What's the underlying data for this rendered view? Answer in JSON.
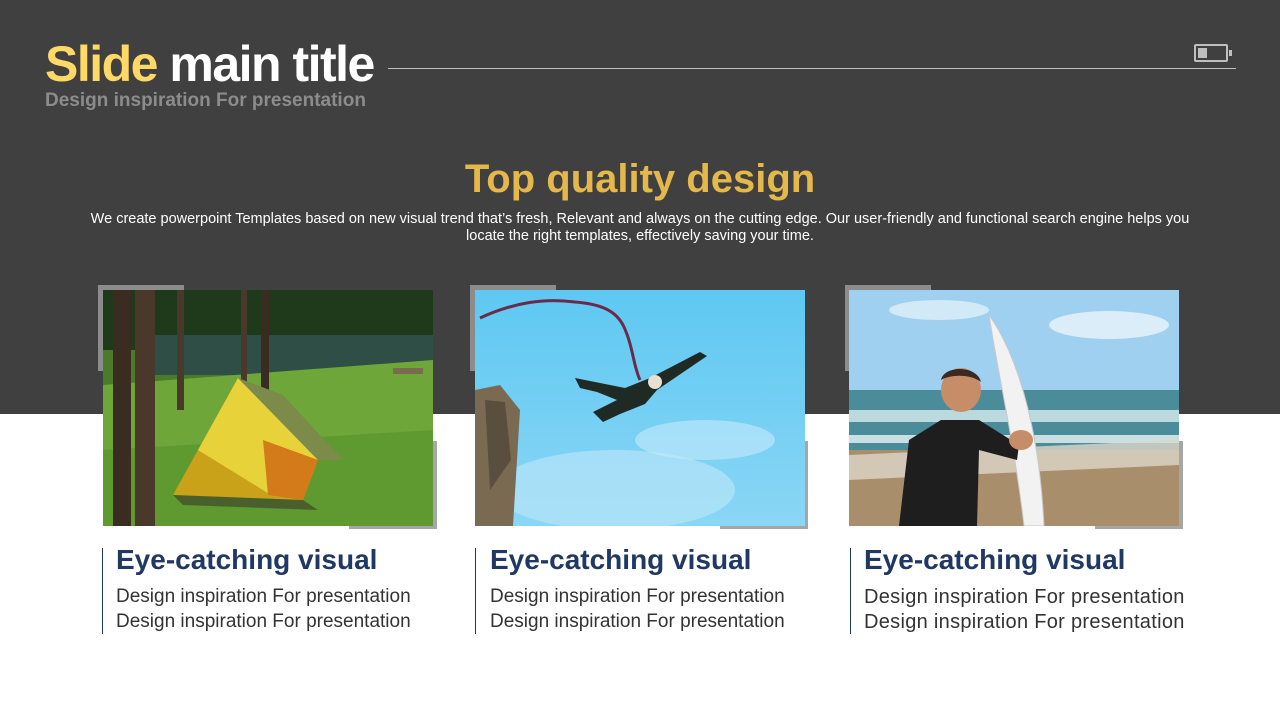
{
  "header": {
    "title_accent": "Slide",
    "title_rest": " main title",
    "subtitle": "Design inspiration For presentation",
    "battery_level": 0.33
  },
  "intro": {
    "heading": "Top quality design",
    "body": "We create powerpoint Templates based on new visual trend that’s fresh, Relevant and always on the cutting edge. Our user-friendly and functional search engine helps you locate the right templates, effectively saving your time."
  },
  "cards": [
    {
      "title": "Eye-catching visual",
      "line1": "Design inspiration For presentation",
      "line2": "Design inspiration For presentation",
      "image": "camping-tent-photo"
    },
    {
      "title": "Eye-catching visual",
      "line1": "Design inspiration For presentation",
      "line2": "Design inspiration For presentation",
      "image": "bungee-jump-photo"
    },
    {
      "title": "Eye-catching visual",
      "line1": "Design inspiration For presentation",
      "line2": "Design inspiration For presentation",
      "image": "surfer-photo"
    }
  ],
  "colors": {
    "band": "#404040",
    "title_accent": "#ffd966",
    "heading": "#e5b84b",
    "caption": "#203864"
  }
}
